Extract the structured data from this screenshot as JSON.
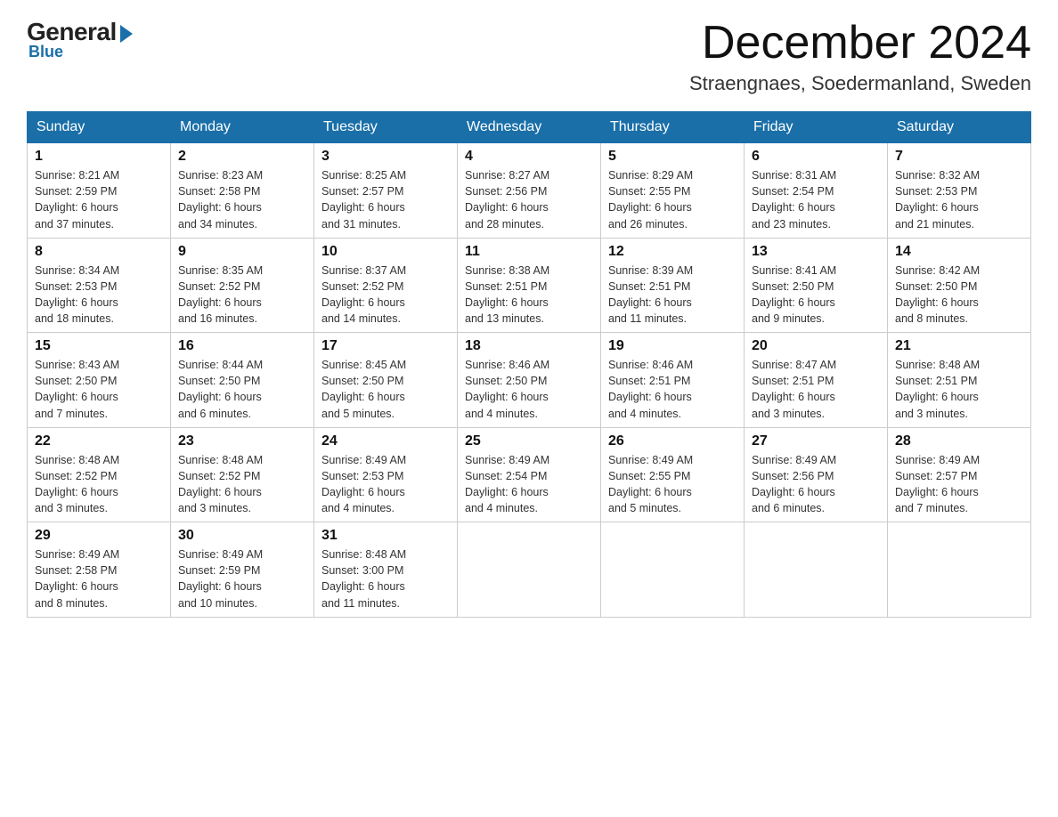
{
  "logo": {
    "general": "General",
    "blue": "Blue"
  },
  "header": {
    "month_year": "December 2024",
    "location": "Straengnaes, Soedermanland, Sweden"
  },
  "days_of_week": [
    "Sunday",
    "Monday",
    "Tuesday",
    "Wednesday",
    "Thursday",
    "Friday",
    "Saturday"
  ],
  "weeks": [
    [
      {
        "day": "1",
        "info": "Sunrise: 8:21 AM\nSunset: 2:59 PM\nDaylight: 6 hours\nand 37 minutes."
      },
      {
        "day": "2",
        "info": "Sunrise: 8:23 AM\nSunset: 2:58 PM\nDaylight: 6 hours\nand 34 minutes."
      },
      {
        "day": "3",
        "info": "Sunrise: 8:25 AM\nSunset: 2:57 PM\nDaylight: 6 hours\nand 31 minutes."
      },
      {
        "day": "4",
        "info": "Sunrise: 8:27 AM\nSunset: 2:56 PM\nDaylight: 6 hours\nand 28 minutes."
      },
      {
        "day": "5",
        "info": "Sunrise: 8:29 AM\nSunset: 2:55 PM\nDaylight: 6 hours\nand 26 minutes."
      },
      {
        "day": "6",
        "info": "Sunrise: 8:31 AM\nSunset: 2:54 PM\nDaylight: 6 hours\nand 23 minutes."
      },
      {
        "day": "7",
        "info": "Sunrise: 8:32 AM\nSunset: 2:53 PM\nDaylight: 6 hours\nand 21 minutes."
      }
    ],
    [
      {
        "day": "8",
        "info": "Sunrise: 8:34 AM\nSunset: 2:53 PM\nDaylight: 6 hours\nand 18 minutes."
      },
      {
        "day": "9",
        "info": "Sunrise: 8:35 AM\nSunset: 2:52 PM\nDaylight: 6 hours\nand 16 minutes."
      },
      {
        "day": "10",
        "info": "Sunrise: 8:37 AM\nSunset: 2:52 PM\nDaylight: 6 hours\nand 14 minutes."
      },
      {
        "day": "11",
        "info": "Sunrise: 8:38 AM\nSunset: 2:51 PM\nDaylight: 6 hours\nand 13 minutes."
      },
      {
        "day": "12",
        "info": "Sunrise: 8:39 AM\nSunset: 2:51 PM\nDaylight: 6 hours\nand 11 minutes."
      },
      {
        "day": "13",
        "info": "Sunrise: 8:41 AM\nSunset: 2:50 PM\nDaylight: 6 hours\nand 9 minutes."
      },
      {
        "day": "14",
        "info": "Sunrise: 8:42 AM\nSunset: 2:50 PM\nDaylight: 6 hours\nand 8 minutes."
      }
    ],
    [
      {
        "day": "15",
        "info": "Sunrise: 8:43 AM\nSunset: 2:50 PM\nDaylight: 6 hours\nand 7 minutes."
      },
      {
        "day": "16",
        "info": "Sunrise: 8:44 AM\nSunset: 2:50 PM\nDaylight: 6 hours\nand 6 minutes."
      },
      {
        "day": "17",
        "info": "Sunrise: 8:45 AM\nSunset: 2:50 PM\nDaylight: 6 hours\nand 5 minutes."
      },
      {
        "day": "18",
        "info": "Sunrise: 8:46 AM\nSunset: 2:50 PM\nDaylight: 6 hours\nand 4 minutes."
      },
      {
        "day": "19",
        "info": "Sunrise: 8:46 AM\nSunset: 2:51 PM\nDaylight: 6 hours\nand 4 minutes."
      },
      {
        "day": "20",
        "info": "Sunrise: 8:47 AM\nSunset: 2:51 PM\nDaylight: 6 hours\nand 3 minutes."
      },
      {
        "day": "21",
        "info": "Sunrise: 8:48 AM\nSunset: 2:51 PM\nDaylight: 6 hours\nand 3 minutes."
      }
    ],
    [
      {
        "day": "22",
        "info": "Sunrise: 8:48 AM\nSunset: 2:52 PM\nDaylight: 6 hours\nand 3 minutes."
      },
      {
        "day": "23",
        "info": "Sunrise: 8:48 AM\nSunset: 2:52 PM\nDaylight: 6 hours\nand 3 minutes."
      },
      {
        "day": "24",
        "info": "Sunrise: 8:49 AM\nSunset: 2:53 PM\nDaylight: 6 hours\nand 4 minutes."
      },
      {
        "day": "25",
        "info": "Sunrise: 8:49 AM\nSunset: 2:54 PM\nDaylight: 6 hours\nand 4 minutes."
      },
      {
        "day": "26",
        "info": "Sunrise: 8:49 AM\nSunset: 2:55 PM\nDaylight: 6 hours\nand 5 minutes."
      },
      {
        "day": "27",
        "info": "Sunrise: 8:49 AM\nSunset: 2:56 PM\nDaylight: 6 hours\nand 6 minutes."
      },
      {
        "day": "28",
        "info": "Sunrise: 8:49 AM\nSunset: 2:57 PM\nDaylight: 6 hours\nand 7 minutes."
      }
    ],
    [
      {
        "day": "29",
        "info": "Sunrise: 8:49 AM\nSunset: 2:58 PM\nDaylight: 6 hours\nand 8 minutes."
      },
      {
        "day": "30",
        "info": "Sunrise: 8:49 AM\nSunset: 2:59 PM\nDaylight: 6 hours\nand 10 minutes."
      },
      {
        "day": "31",
        "info": "Sunrise: 8:48 AM\nSunset: 3:00 PM\nDaylight: 6 hours\nand 11 minutes."
      },
      {
        "day": "",
        "info": ""
      },
      {
        "day": "",
        "info": ""
      },
      {
        "day": "",
        "info": ""
      },
      {
        "day": "",
        "info": ""
      }
    ]
  ]
}
